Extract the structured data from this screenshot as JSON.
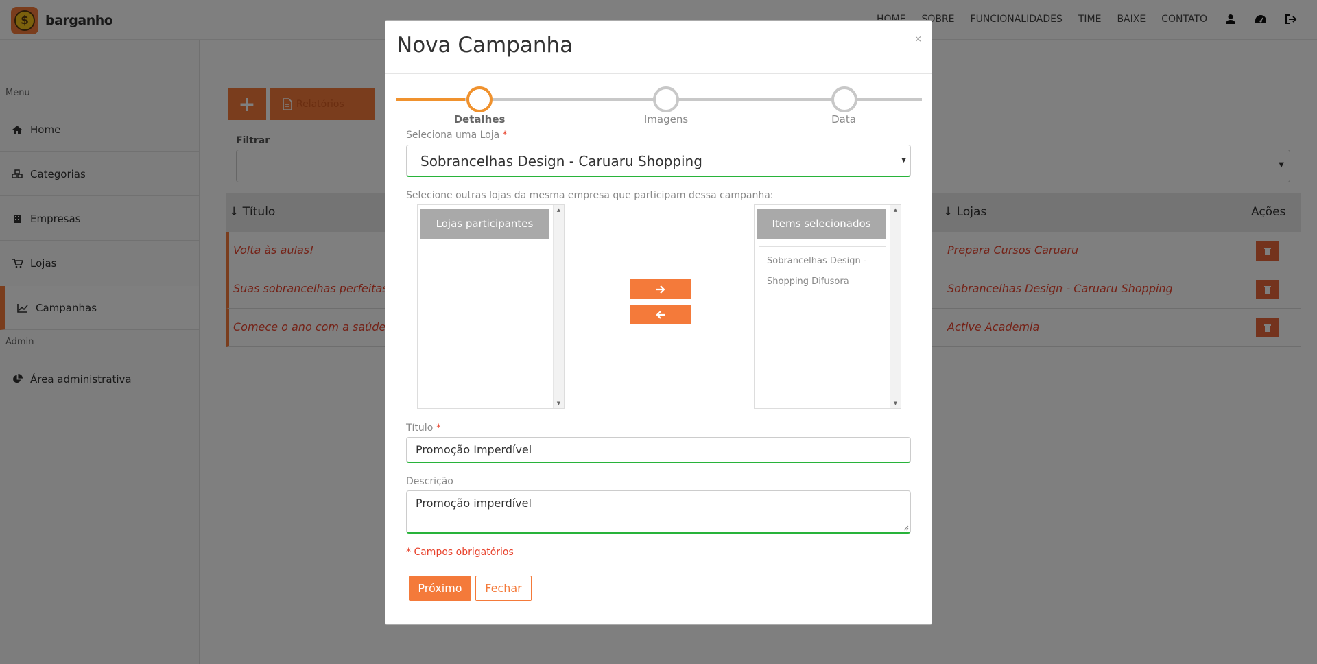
{
  "brand": {
    "name": "barganho",
    "logo_glyph": "$"
  },
  "nav": {
    "links": [
      "HOME",
      "SOBRE",
      "FUNCIONALIDADES",
      "TIME",
      "BAIXE",
      "CONTATO"
    ],
    "icons": [
      "user-icon",
      "dashboard-icon",
      "logout-icon"
    ]
  },
  "sidebar": {
    "menu_heading": "Menu",
    "items": [
      {
        "label": "Home",
        "icon": "home-icon"
      },
      {
        "label": "Categorias",
        "icon": "cubes-icon"
      },
      {
        "label": "Empresas",
        "icon": "building-icon"
      },
      {
        "label": "Lojas",
        "icon": "cart-icon"
      },
      {
        "label": "Campanhas",
        "icon": "chart-icon",
        "active": true
      }
    ],
    "admin_heading": "Admin",
    "admin_items": [
      {
        "label": "Área administrativa",
        "icon": "pie-chart-icon"
      }
    ]
  },
  "main": {
    "add_button": "+",
    "report_button": "Relatórios",
    "filter_label": "Filtrar",
    "table": {
      "headers": [
        "↓ Título",
        "↓ Lojas",
        "Ações"
      ],
      "rows": [
        {
          "titulo": "Volta às aulas!",
          "loja": "Prepara Cursos Caruaru"
        },
        {
          "titulo": "Suas sobrancelhas perfeitas",
          "loja": "Sobrancelhas Design - Caruaru Shopping"
        },
        {
          "titulo": "Comece o ano com a saúde",
          "loja": "Active Academia"
        }
      ]
    }
  },
  "modal": {
    "title": "Nova Campanha",
    "close": "×",
    "steps": [
      {
        "label": "Detalhes",
        "active": true
      },
      {
        "label": "Imagens",
        "active": false
      },
      {
        "label": "Data",
        "active": false
      }
    ],
    "store_label": "Seleciona uma Loja",
    "required_mark": "*",
    "store_value": "Sobrancelhas Design - Caruaru Shopping",
    "other_stores_label": "Selecione outras lojas da mesma empresa que participam dessa campanha:",
    "available_header": "Lojas participantes",
    "selected_header": "Items selecionados",
    "selected_items": [
      "Sobrancelhas Design - Shopping Difusora"
    ],
    "titulo_label": "Título",
    "titulo_value": "Promoção Imperdível",
    "descricao_label": "Descrição",
    "descricao_value": "Promoção imperdível",
    "required_note": "* Campos obrigatórios",
    "next_button": "Próximo",
    "close_button": "Fechar"
  },
  "colors": {
    "accent": "#f47a3a",
    "step_active": "#f0922e",
    "valid": "#28b33a",
    "error_text": "#e8442e"
  }
}
